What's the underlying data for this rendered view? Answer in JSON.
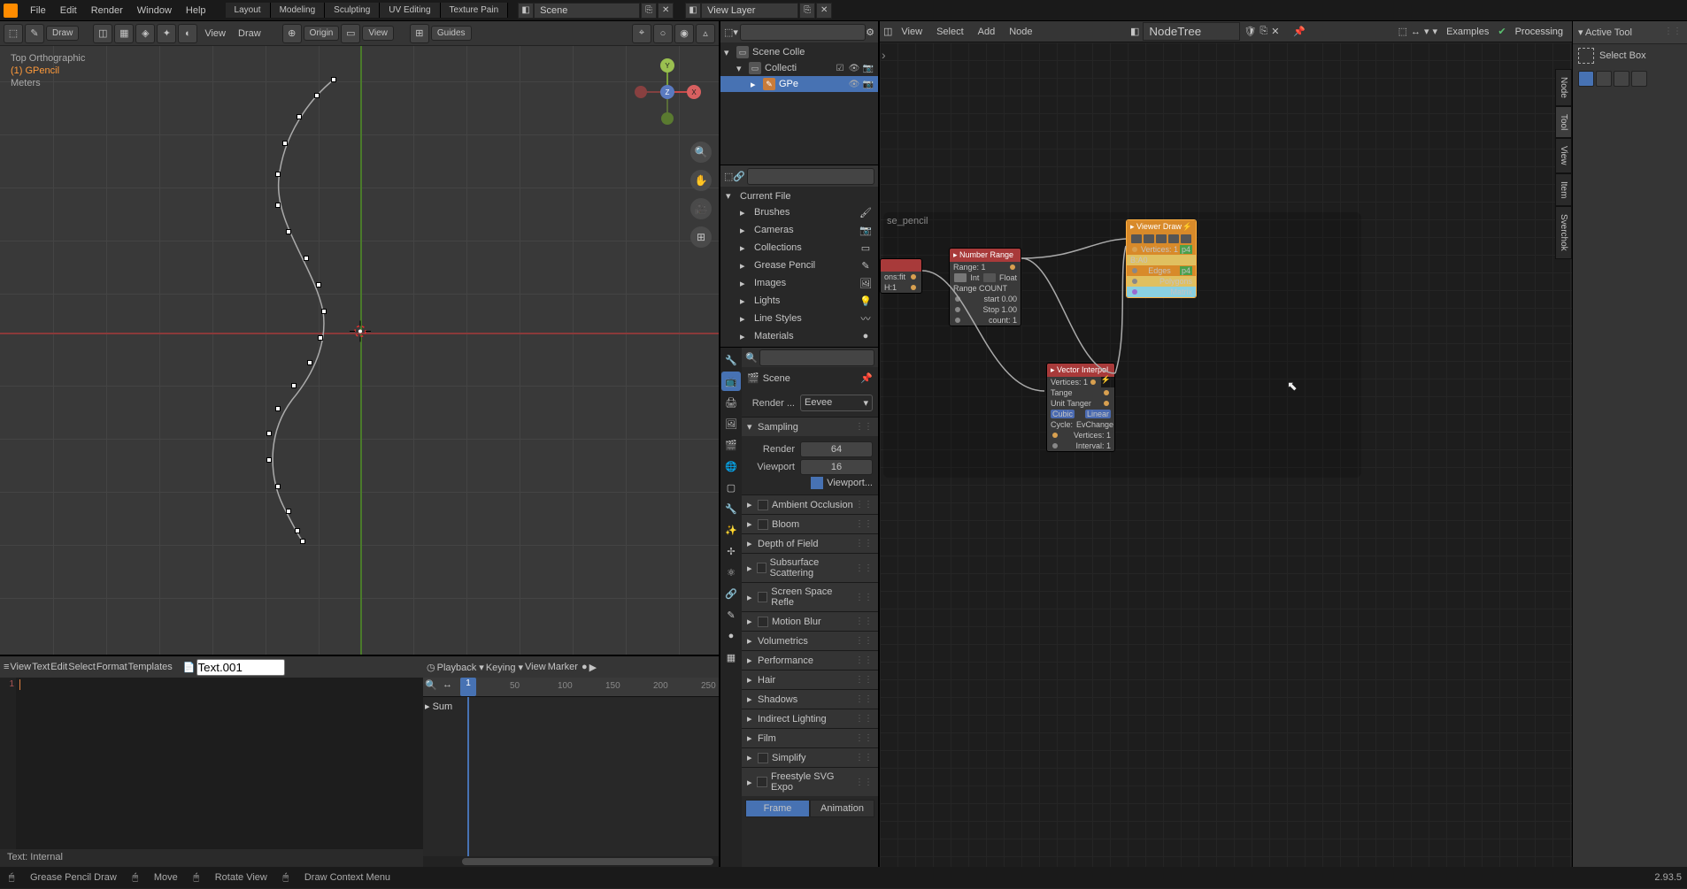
{
  "top": {
    "menus": [
      "File",
      "Edit",
      "Render",
      "Window",
      "Help"
    ],
    "workspaces": [
      "Layout",
      "Modeling",
      "Sculpting",
      "UV Editing",
      "Texture Pain"
    ],
    "scene": "Scene",
    "layer": "View Layer"
  },
  "viewport": {
    "mode": "Draw",
    "origin": "Origin",
    "view_menu": "View",
    "draw_menu": "Draw",
    "guides": "Guides",
    "overlay_top": "Top Orthographic",
    "overlay_obj": "(1) GPencil",
    "overlay_units": "Meters"
  },
  "outliner": {
    "root": "Scene Colle",
    "collection": "Collecti",
    "object": "GPe"
  },
  "filebrowser": {
    "root": "Current File",
    "items": [
      "Brushes",
      "Cameras",
      "Collections",
      "Grease Pencil",
      "Images",
      "Lights",
      "Line Styles",
      "Materials"
    ]
  },
  "properties": {
    "scene": "Scene",
    "render_label": "Render ...",
    "render_engine": "Eevee",
    "sampling": "Sampling",
    "render_samples_label": "Render",
    "render_samples": "64",
    "viewport_label": "Viewport",
    "viewport_samples": "16",
    "viewport_denoise": "Viewport...",
    "sections": [
      "Ambient Occlusion",
      "Bloom",
      "Depth of Field",
      "Subsurface Scattering",
      "Screen Space Refle",
      "Motion Blur",
      "Volumetrics",
      "Performance",
      "Hair",
      "Shadows",
      "Indirect Lighting",
      "Film",
      "Simplify",
      "Freestyle SVG Expo"
    ],
    "sections_check": [
      true,
      true,
      false,
      true,
      true,
      true,
      false,
      false,
      false,
      false,
      false,
      false,
      true,
      true
    ],
    "toggle": {
      "frame": "Frame",
      "anim": "Animation"
    }
  },
  "nodeeditor": {
    "menus": [
      "View",
      "Select",
      "Add",
      "Node"
    ],
    "tree": "NodeTree",
    "examples": "Examples",
    "processing": "Processing",
    "group_label": "se_pencil",
    "nodes": {
      "scene_objects": {
        "title": "",
        "rows": [
          "ons:fit",
          "H:1"
        ]
      },
      "number_range": {
        "title": "Number Range",
        "rows": [
          "Range: 1",
          "Int",
          "Float",
          "Range COUNT",
          "start       0.00",
          "Stop      1.00",
          "count: 1"
        ]
      },
      "interpol": {
        "title": "Vector Interpol",
        "rows": [
          "Vertices: 1",
          "Tange",
          "Unit Tanger",
          "Cubic",
          "Linear",
          "Cycle:",
          "EvChange",
          "Vertices: 1",
          "Interval: 1"
        ]
      },
      "viewer": {
        "title": "Viewer Draw",
        "rows": [
          "Vertices: 1",
          "p4",
          "B:A0",
          "Edges",
          "p4",
          "Polygons",
          "Matrix"
        ]
      }
    }
  },
  "right_panel": {
    "title": "Active Tool",
    "tool": "Select Box",
    "vtabs": [
      "Node",
      "Tool",
      "View",
      "Item",
      "Sverchok"
    ]
  },
  "text_editor": {
    "menus": [
      "View",
      "Text",
      "Edit",
      "Select",
      "Format",
      "Templates"
    ],
    "datablock": "Text.001",
    "gutter_1": "1",
    "footer": "Text: Internal"
  },
  "timeline": {
    "menus": [
      "Playback",
      "Keying",
      "View",
      "Marker"
    ],
    "current": "1",
    "ticks": [
      "50",
      "100",
      "150",
      "200",
      "250"
    ],
    "summary": "▸ Sum"
  },
  "status": {
    "a": "Grease Pencil Draw",
    "b": "Move",
    "c": "Rotate View",
    "d": "Draw Context Menu",
    "version": "2.93.5"
  },
  "view_btn": "View"
}
